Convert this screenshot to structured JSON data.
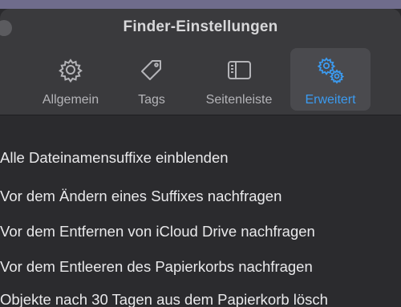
{
  "window": {
    "title": "Finder-Einstellungen"
  },
  "tabs": [
    {
      "label": "Allgemein",
      "icon": "gear-icon",
      "active": false
    },
    {
      "label": "Tags",
      "icon": "tag-icon",
      "active": false
    },
    {
      "label": "Seitenleiste",
      "icon": "sidebar-icon",
      "active": false
    },
    {
      "label": "Erweitert",
      "icon": "gears-icon",
      "active": true
    }
  ],
  "colors": {
    "accent": "#3b9bf1",
    "background": "#2b2b2e",
    "text": "#e9e9eb"
  },
  "options": [
    {
      "label": "Alle Dateinamensuffixe einblenden"
    },
    {
      "label": "Vor dem Ändern eines Suffixes nachfragen"
    },
    {
      "label": "Vor dem Entfernen von iCloud Drive nachfragen"
    },
    {
      "label": "Vor dem Entleeren des Papierkorbs nachfragen"
    },
    {
      "label": "Objekte nach 30 Tagen aus dem Papierkorb lösch"
    }
  ]
}
